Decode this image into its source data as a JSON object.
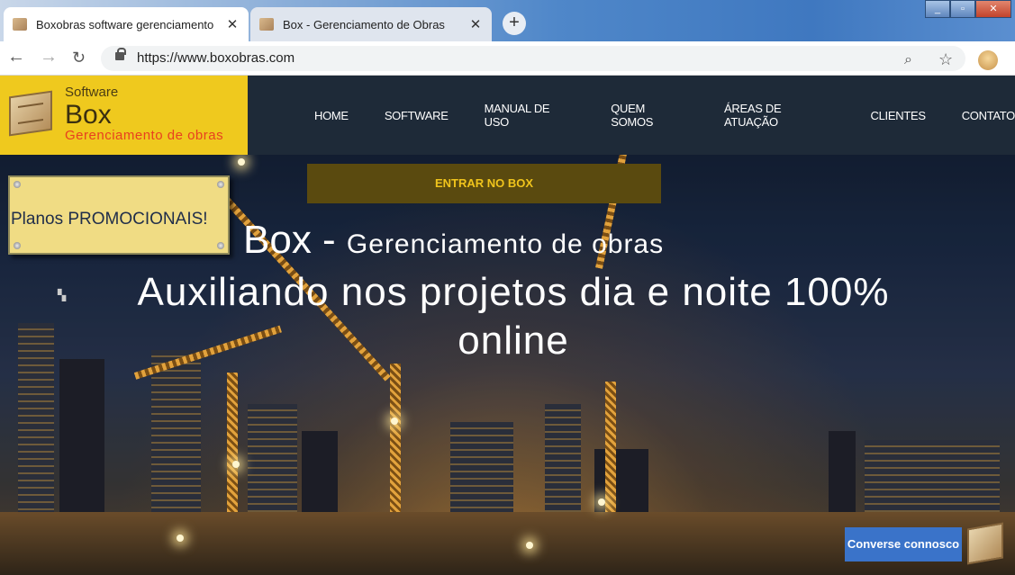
{
  "browser": {
    "tabs": [
      {
        "title": "Boxobras software gerenciamento",
        "close": "✕"
      },
      {
        "title": "Box - Gerenciamento de Obras",
        "close": "✕"
      }
    ],
    "new_tab": "+",
    "url": "https://www.boxobras.com",
    "icons": [
      "back-icon",
      "forward-icon",
      "reload-icon",
      "lock-icon",
      "zoom-icon",
      "star-icon",
      "profile-icon"
    ]
  },
  "site": {
    "logo": {
      "small": "Software",
      "big": "Box",
      "sub": "Gerenciamento de obras"
    },
    "menu": [
      "HOME",
      "SOFTWARE",
      "MANUAL DE USO",
      "QUEM SOMOS",
      "ÁREAS DE ATUAÇÃO",
      "CLIENTES",
      "CONTATO"
    ],
    "enter_button": "ENTRAR NO BOX",
    "promo": "Planos PROMOCIONAIS!",
    "hero": {
      "title_big": "Box - ",
      "title_mid": "Gerenciamento de obras",
      "subtitle": "Auxiliando nos projetos dia e noite 100% online"
    },
    "chat_button": "Converse connosco"
  },
  "colors": {
    "logo_bg": "#efc91e",
    "navbar": "#1e2a38",
    "enter_bg": "#5a4a0f",
    "enter_text": "#f0c41c",
    "promo_bg": "#f0dc84",
    "chat_bg": "#3a73c9"
  }
}
